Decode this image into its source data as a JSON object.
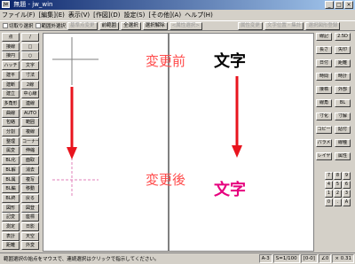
{
  "window": {
    "title": "無題 - jw_win",
    "icon": "jw-app-icon",
    "min": "_",
    "max": "□",
    "close": "×"
  },
  "menu": [
    "ファイル(F)",
    "[編集](E)",
    "表示(V)",
    "[作図](D)",
    "設定(S)",
    "[その他](A)",
    "ヘルプ(H)"
  ],
  "toolbar": {
    "chk1": "切取り選択",
    "chk2": "範囲外選択",
    "btn_base": "基準点変更",
    "btn_prev": "前範囲",
    "btn_all": "全選択",
    "btn_end": "選択解除",
    "btn_attr": "<属性選択>",
    "right1": "属性変更",
    "right2": "文字位置・集計",
    "right3": "選択図形登録"
  },
  "left_panel": [
    [
      "点",
      "/"
    ],
    [
      "接線",
      "□"
    ],
    [
      "接円",
      "○"
    ],
    [
      "ハッチ",
      "文字"
    ],
    [
      "建平",
      "寸法"
    ],
    [
      "建断",
      "2線"
    ],
    [
      "建立",
      "中心線"
    ],
    [
      "多角形",
      "連線"
    ],
    [
      "曲線",
      "AUTO"
    ],
    [
      "包絡",
      "範囲"
    ],
    [
      "分割",
      "複線"
    ],
    [
      "整理",
      "コーナー"
    ],
    [
      "属変",
      "伸縮"
    ],
    [
      "BL化",
      "面取"
    ],
    [
      "BL解",
      "消去"
    ],
    [
      "BL属",
      "複写"
    ],
    [
      "BL編",
      "移動"
    ],
    [
      "BL終",
      "戻る"
    ],
    [
      "図形",
      "図登"
    ],
    [
      "記変",
      "座標"
    ],
    [
      "測定",
      "日影"
    ],
    [
      "表計",
      "天空"
    ],
    [
      "距離",
      "外変"
    ]
  ],
  "right_panel": [
    [
      "線記",
      "2.5D"
    ],
    [
      "長さ",
      "矢印"
    ],
    [
      "日付",
      "距離"
    ],
    [
      "時間",
      "時計"
    ],
    [
      "接楕",
      "外部"
    ],
    [
      "線角",
      "BL"
    ],
    [
      "寸化",
      "寸解"
    ],
    [
      "コピー",
      "貼付"
    ],
    [
      "パラメ",
      "線種"
    ],
    [
      "レイヤ",
      "属性"
    ]
  ],
  "numpad": [
    "7",
    "8",
    "9",
    "4",
    "5",
    "6",
    "1",
    "2",
    "3",
    "0",
    ".",
    "A"
  ],
  "canvas": {
    "before_label": "変更前",
    "after_label": "変更後",
    "text_before": "文字",
    "text_after": "文字",
    "colors": {
      "label_red": "#ff4b4b",
      "arrow_red": "#e8141e",
      "text_black": "#000000",
      "text_magenta": "#e6007e",
      "cross_gray": "#7f7f7f",
      "cross_pink": "#e07fb8",
      "divider": "#000000"
    }
  },
  "status": {
    "message": "範囲選択の始点をマウスで、連続選択はクリックで指示してください。",
    "layer": "A-3",
    "scale": "S=1/100",
    "group": "[0-0]",
    "zoom": "∠0",
    "ratio": "× 0.31"
  }
}
